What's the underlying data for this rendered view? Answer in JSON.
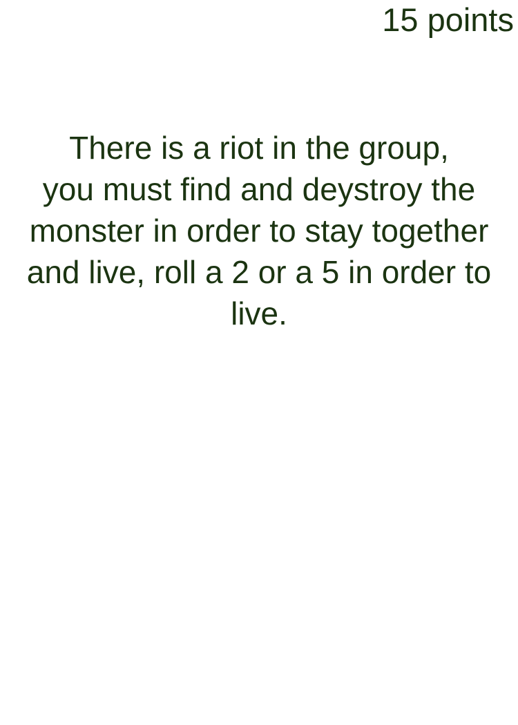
{
  "card": {
    "points": "15 points",
    "text_lines": [
      "There is a riot in the group,",
      "you must find and deystroy the",
      "monster in order to stay together",
      "and live, roll a 2 or a 5 in order to",
      "live."
    ],
    "text_color": "#1b3411",
    "background_color": "#ffffff"
  }
}
